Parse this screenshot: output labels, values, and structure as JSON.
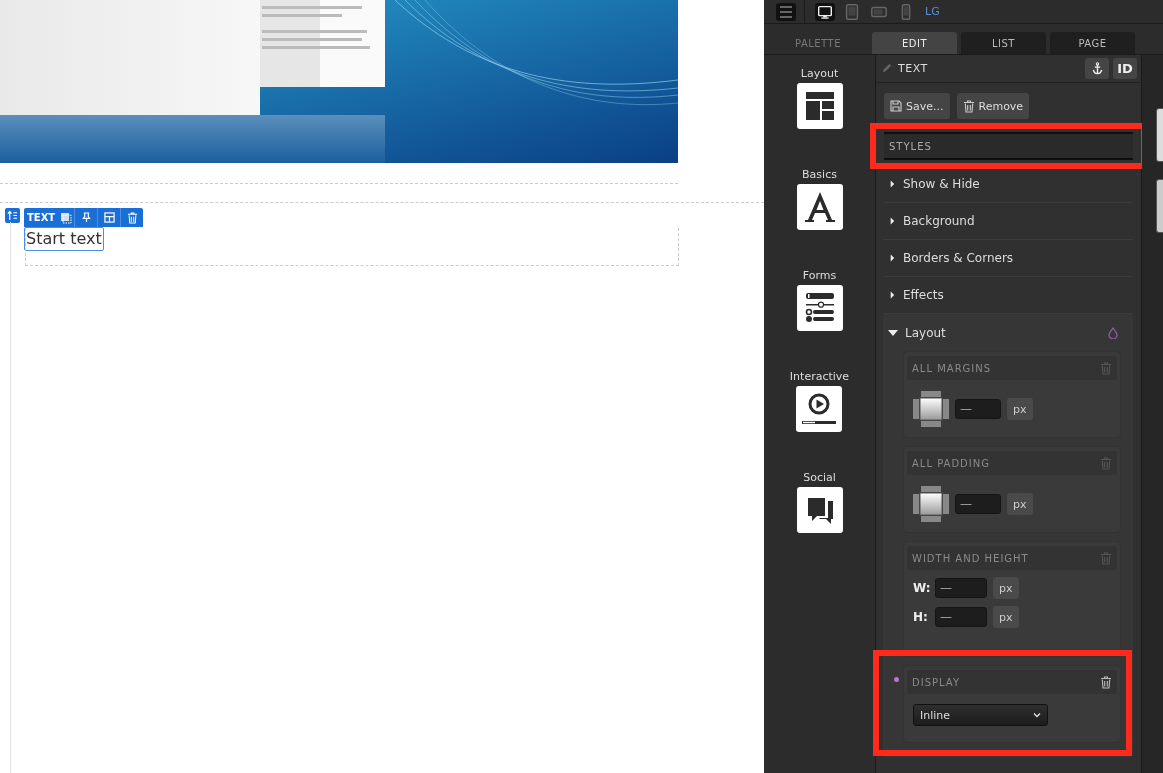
{
  "canvas": {
    "element_toolbar": {
      "label": "TEXT"
    },
    "text_element": {
      "text": "Start text"
    }
  },
  "topbar": {
    "devices": [
      {
        "kind": "desktop",
        "selected": true
      },
      {
        "kind": "tablet",
        "selected": false
      },
      {
        "kind": "tablet-landscape",
        "selected": false
      },
      {
        "kind": "phone",
        "selected": false
      }
    ],
    "size_label": "LG"
  },
  "tabs": [
    {
      "label": "PALETTE",
      "selected": false
    },
    {
      "label": "EDIT",
      "selected": true
    },
    {
      "label": "LIST",
      "selected": false
    },
    {
      "label": "PAGE",
      "selected": false
    }
  ],
  "palette": [
    {
      "label": "Layout",
      "kind": "layout"
    },
    {
      "label": "Basics",
      "kind": "basics"
    },
    {
      "label": "Forms",
      "kind": "forms"
    },
    {
      "label": "Interactive",
      "kind": "interactive"
    },
    {
      "label": "Social",
      "kind": "social"
    }
  ],
  "editor": {
    "element_type": "TEXT",
    "id_button": "ID",
    "buttons": [
      {
        "label": "Save...",
        "kind": "save"
      },
      {
        "label": "Remove",
        "kind": "remove"
      }
    ],
    "styles_header": {
      "label": "STYLES",
      "highlighted": true
    },
    "sections": [
      {
        "label": "Show & Hide",
        "expanded": false
      },
      {
        "label": "Background",
        "expanded": false
      },
      {
        "label": "Borders & Corners",
        "expanded": false
      },
      {
        "label": "Effects",
        "expanded": false
      },
      {
        "label": "Layout",
        "expanded": true,
        "groups": [
          {
            "title": "ALL MARGINS",
            "kind": "box",
            "modified": false,
            "highlighted": false,
            "fields": [
              {
                "placeholder": "—",
                "unit": "px"
              }
            ]
          },
          {
            "title": "ALL PADDING",
            "kind": "box",
            "modified": false,
            "highlighted": false,
            "fields": [
              {
                "placeholder": "—",
                "unit": "px"
              }
            ]
          },
          {
            "title": "WIDTH AND HEIGHT",
            "kind": "dimensions",
            "modified": false,
            "highlighted": false,
            "fields": [
              {
                "label": "W:",
                "placeholder": "—",
                "unit": "px"
              },
              {
                "label": "H:",
                "placeholder": "—",
                "unit": "px"
              }
            ]
          },
          {
            "title": "DISPLAY",
            "kind": "select",
            "modified": true,
            "highlighted": true,
            "value": "Inline"
          }
        ]
      }
    ]
  }
}
